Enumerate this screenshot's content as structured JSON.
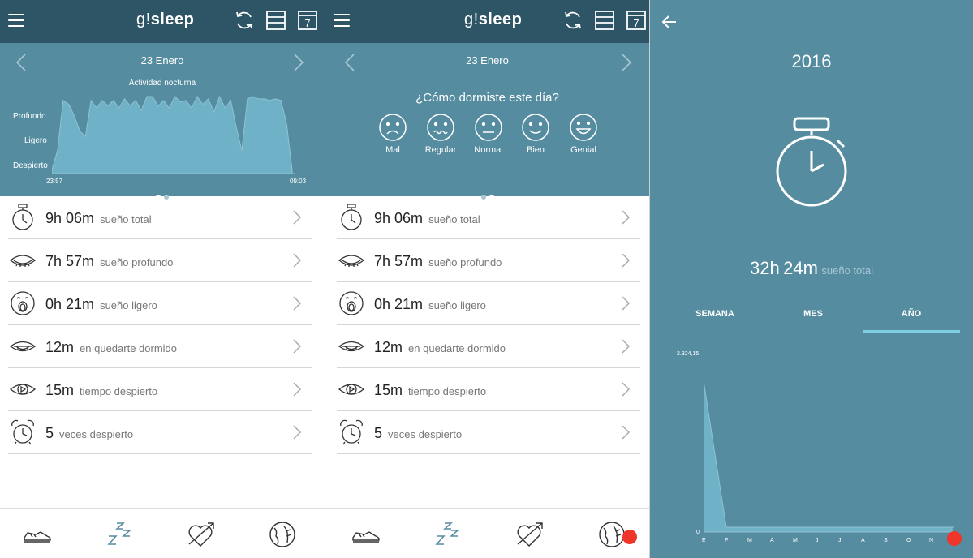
{
  "app": {
    "logo_prefix": "g!",
    "logo_suffix": "sleep",
    "calendar_day": "7"
  },
  "panel1": {
    "date": "23 Enero",
    "chart_title": "Actividad nocturna",
    "y_labels": [
      "Profundo",
      "Ligero",
      "Despierto"
    ],
    "x_start": "23:57",
    "x_end": "09:03"
  },
  "panel2": {
    "date": "23 Enero",
    "question": "¿Cómo dormiste este día?",
    "moods": [
      {
        "label": "Mal",
        "icon": "sad-face-icon"
      },
      {
        "label": "Regular",
        "icon": "wavy-mouth-face-icon"
      },
      {
        "label": "Normal",
        "icon": "neutral-face-icon"
      },
      {
        "label": "Bien",
        "icon": "smile-face-icon"
      },
      {
        "label": "Genial",
        "icon": "big-smile-face-icon"
      }
    ]
  },
  "stats": [
    {
      "value": "9h 06m",
      "label": "sueño total",
      "icon": "stopwatch-icon"
    },
    {
      "value": "7h 57m",
      "label": "sueño profundo",
      "icon": "closed-eye-icon"
    },
    {
      "value": "0h 21m",
      "label": "sueño ligero",
      "icon": "yawn-face-icon"
    },
    {
      "value": "12m",
      "label": "en quedarte dormido",
      "icon": "drowsy-eye-icon"
    },
    {
      "value": "15m",
      "label": "tiempo despierto",
      "icon": "open-eye-icon"
    },
    {
      "value": "5",
      "label": "veces despierto",
      "icon": "alarm-clock-icon"
    }
  ],
  "bottom_nav": [
    "sneaker-icon",
    "zzz-icon",
    "heart-arrow-icon",
    "globe-leaf-icon"
  ],
  "panel3": {
    "year": "2016",
    "total_hours": "32h",
    "total_minutes": "24m",
    "total_label": "sueño total",
    "tabs": [
      {
        "label": "SEMANA",
        "active": false
      },
      {
        "label": "MES",
        "active": false
      },
      {
        "label": "AÑO",
        "active": true
      }
    ]
  },
  "colors": {
    "header": "#2e5566",
    "panel": "#558ca0",
    "accent": "#7fcde3",
    "badge": "#f0352a"
  },
  "chart_data": [
    {
      "type": "area",
      "title": "Actividad nocturna",
      "x_range": [
        "23:57",
        "09:03"
      ],
      "y_categories": [
        "Despierto",
        "Ligero",
        "Profundo"
      ],
      "ylim": [
        0,
        1
      ],
      "grid": false,
      "values": [
        0.05,
        0.3,
        0.95,
        0.9,
        0.75,
        0.55,
        0.48,
        0.95,
        0.85,
        0.95,
        0.88,
        0.95,
        0.85,
        0.97,
        0.88,
        0.95,
        0.82,
        1.0,
        1.0,
        0.88,
        0.95,
        0.85,
        1.0,
        0.93,
        0.95,
        0.85,
        1.0,
        0.9,
        0.97,
        0.8,
        1.0,
        0.85,
        0.95,
        0.6,
        0.3,
        0.97,
        1.0,
        0.97,
        0.97,
        0.95,
        0.97,
        0.95,
        0.65,
        0.05
      ]
    },
    {
      "type": "area",
      "categories": [
        "E",
        "F",
        "M",
        "A",
        "M",
        "J",
        "J",
        "A",
        "S",
        "O",
        "N",
        "D"
      ],
      "values": [
        2324.15,
        0,
        0,
        0,
        0,
        0,
        0,
        0,
        0,
        0,
        0,
        0
      ],
      "y_tick_labels": [
        "0",
        "2.324,15"
      ],
      "ylim": [
        0,
        2324.15
      ],
      "grid": false
    }
  ]
}
